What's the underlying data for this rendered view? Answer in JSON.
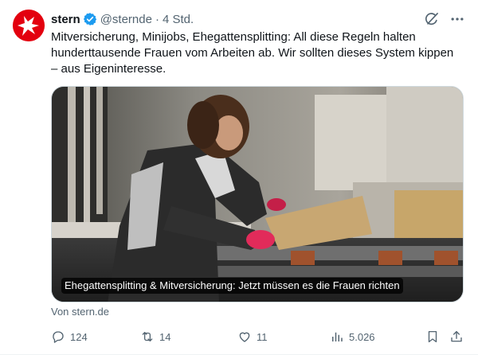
{
  "author": {
    "name": "stern",
    "handle": "@sternde",
    "separator": "·",
    "time": "4 Std."
  },
  "tweet": {
    "text": "Mitversicherung, Minijobs, Ehegattensplitting: All diese Regeln halten hunderttausende Frauen vom Arbeiten ab. Wir sollten dieses System kippen – aus Eigeninteresse."
  },
  "card": {
    "caption": "Ehegattensplitting & Mitversicherung: Jetzt müssen es die Frauen richten",
    "source": "Von stern.de"
  },
  "metrics": {
    "replies": "124",
    "reposts": "14",
    "likes": "11",
    "views": "5.026"
  },
  "colors": {
    "brand": "#e3000f",
    "verified": "#1d9bf0",
    "muted": "#536471"
  }
}
